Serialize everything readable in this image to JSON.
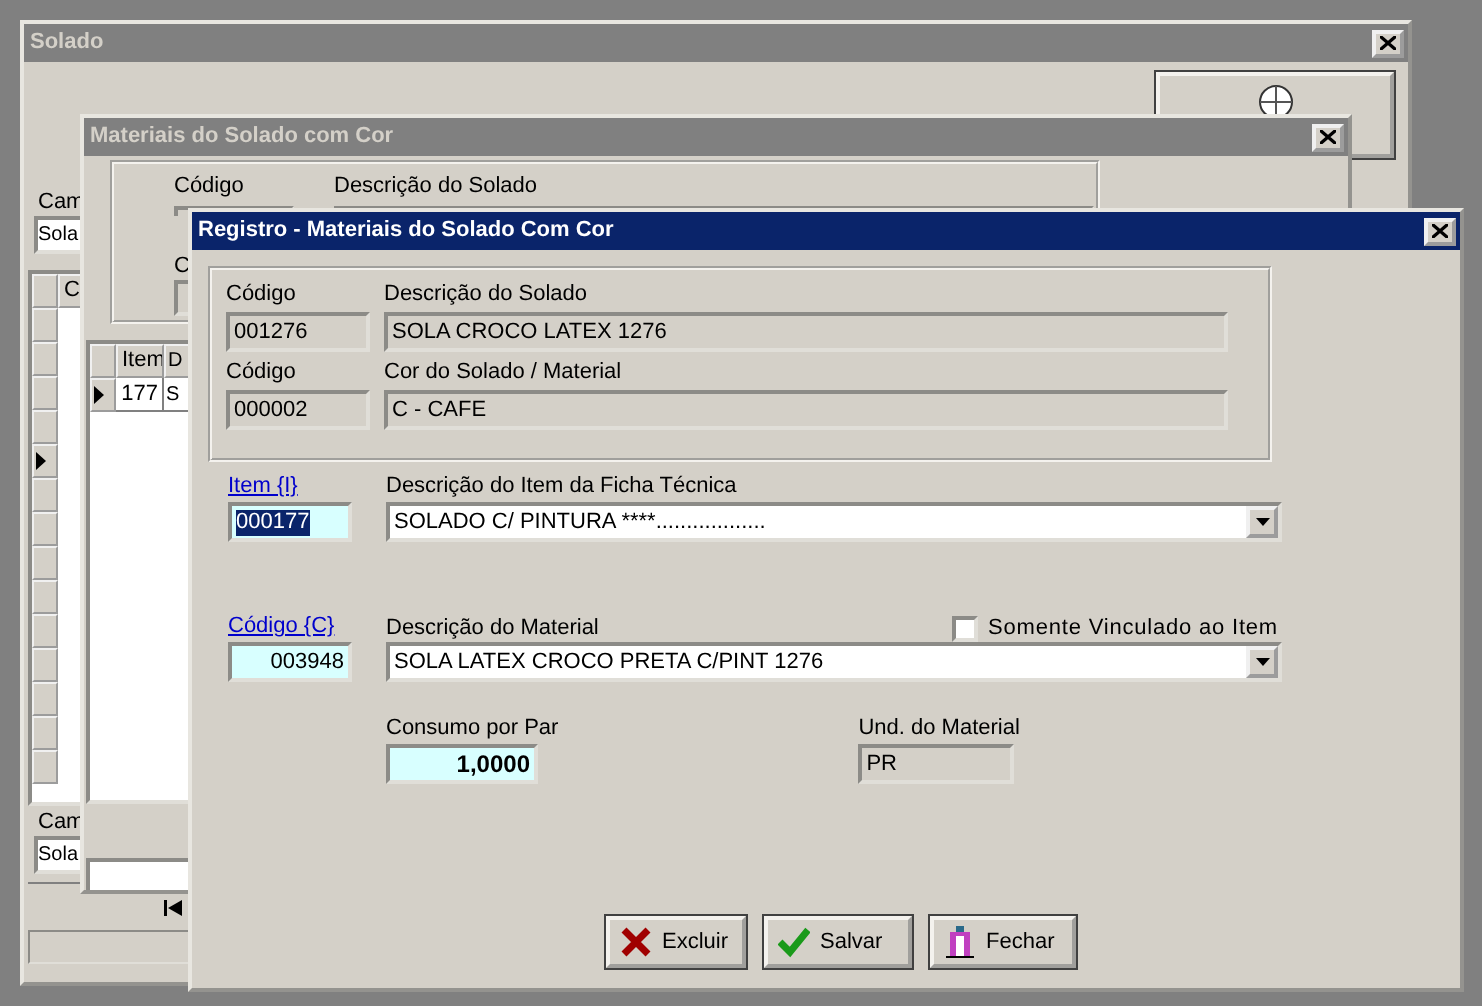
{
  "solado_window": {
    "title": "Solado",
    "active": false,
    "top_search": {
      "label": "Cam",
      "value": "Sola"
    },
    "grid": {
      "columns": [
        "C"
      ],
      "rows": [
        {
          "selected": false
        },
        {
          "selected": false
        },
        {
          "selected": false
        },
        {
          "selected": false
        },
        {
          "selected": true
        },
        {
          "selected": false
        },
        {
          "selected": false
        },
        {
          "selected": false
        },
        {
          "selected": false
        },
        {
          "selected": false
        },
        {
          "selected": false
        },
        {
          "selected": false
        },
        {
          "selected": false
        },
        {
          "selected": false
        }
      ]
    },
    "bottom_search": {
      "label": "Cam",
      "value": "Sola"
    }
  },
  "materiais_window": {
    "title": "Materiais do Solado com Cor",
    "active": false,
    "labels": [
      "Código",
      "Descrição do Solado"
    ],
    "partial_label": "C",
    "grid": {
      "columns": [
        "Item",
        "D"
      ],
      "rows": [
        {
          "cells": [
            "177",
            "S"
          ],
          "selected": true
        }
      ]
    }
  },
  "registro_window": {
    "title": "Registro - Materiais do Solado Com Cor",
    "active": true,
    "header_fields": [
      [
        {
          "label": "Código",
          "value": "001276"
        },
        {
          "label": "Descrição do Solado",
          "value": "SOLA CROCO LATEX 1276"
        }
      ],
      [
        {
          "label": "Código",
          "value": "000002"
        },
        {
          "label": "Cor do Solado / Material",
          "value": "C - CAFE"
        }
      ]
    ],
    "item": {
      "link": "Item {I}",
      "value": "000177",
      "value_selected": true,
      "description_label": "Descrição do Item da Ficha Técnica",
      "description": "SOLADO C/ PINTURA ****.................."
    },
    "material": {
      "link": "Código {C}",
      "value": "003948",
      "description_label": "Descrição do Material",
      "description": "SOLA LATEX CROCO PRETA C/PINT 1276",
      "checkbox": {
        "label": "Somente Vinculado ao Item",
        "checked": false
      }
    },
    "consumo": {
      "label": "Consumo por Par",
      "value": "1,0000"
    },
    "unidade": {
      "label": "Und. do Material",
      "value": "PR"
    },
    "buttons": [
      {
        "kind": "delete",
        "label": "Excluir"
      },
      {
        "kind": "save",
        "label": "Salvar"
      },
      {
        "kind": "close",
        "label": "Fechar"
      }
    ]
  }
}
